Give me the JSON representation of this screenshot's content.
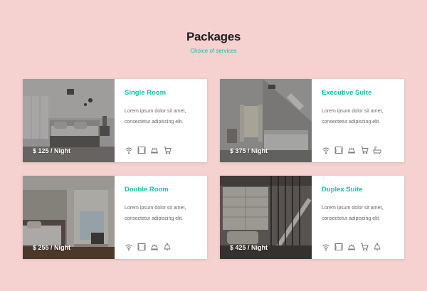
{
  "header": {
    "title": "Packages",
    "subtitle": "Choice of services"
  },
  "colors": {
    "background": "#f5d2d0",
    "accent": "#17c0a8",
    "title": "#1f1f1f"
  },
  "packages": [
    {
      "name": "Single Room",
      "price": "$ 125 / Night",
      "description": "Lorem ipsum dolor sit amet, consectetur adipiscing elit.",
      "icons": [
        "wifi-icon",
        "window-curtain-icon",
        "room-service-icon",
        "cart-icon"
      ]
    },
    {
      "name": "Executive Suite",
      "price": "$ 375 / Night",
      "description": "Lorem ipsum dolor sit amet, consectetur adipiscing elit.",
      "icons": [
        "wifi-icon",
        "window-curtain-icon",
        "room-service-icon",
        "cart-icon",
        "bathtub-icon"
      ]
    },
    {
      "name": "Double Room",
      "price": "$ 255 / Night",
      "description": "Lorem ipsum dolor sit amet, consectetur adipiscing elit.",
      "icons": [
        "wifi-icon",
        "window-curtain-icon",
        "room-service-icon",
        "bell-icon"
      ]
    },
    {
      "name": "Duplex Suite",
      "price": "$ 425 / Night",
      "description": "Lorem ipsum dolor sit amet, consectetur adipiscing elit.",
      "icons": [
        "wifi-icon",
        "window-curtain-icon",
        "room-service-icon",
        "cart-icon",
        "bell-icon"
      ]
    }
  ]
}
